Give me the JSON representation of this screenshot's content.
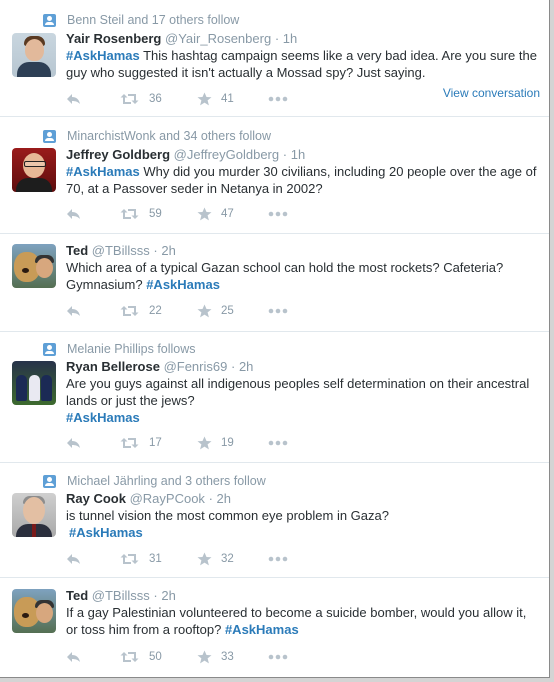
{
  "tweets": [
    {
      "context": "Benn Steil and 17 others follow",
      "fullname": "Yair Rosenberg",
      "handle": "@Yair_Rosenberg",
      "time": "1h",
      "hashtag": "#AskHamas",
      "text_after": " This hashtag campaign seems like a very bad idea. Are you sure the guy who suggested it isn't actually a Mossad spy? Just saying.",
      "retweets": "36",
      "favorites": "41",
      "view_conversation": "View conversation"
    },
    {
      "context": "MinarchistWonk and 34 others follow",
      "fullname": "Jeffrey Goldberg",
      "handle": "@JeffreyGoldberg",
      "time": "1h",
      "hashtag": "#AskHamas",
      "text_after": " Why did you murder 30 civilians, including 20 people over the age of 70, at a Passover seder in Netanya in 2002?",
      "retweets": "59",
      "favorites": "47"
    },
    {
      "fullname": "Ted",
      "handle": "@TBillsss",
      "time": "2h",
      "text_before": "Which area of a typical Gazan school can hold the most rockets? Cafeteria? Gymnasium? ",
      "hashtag": "#AskHamas",
      "retweets": "22",
      "favorites": "25"
    },
    {
      "context": "Melanie Phillips follows",
      "fullname": "Ryan Bellerose",
      "handle": "@Fenris69",
      "time": "2h",
      "text_before": "Are you guys against all indigenous peoples self determination on their ancestral lands or just the jews?",
      "hashtag": "#AskHamas",
      "retweets": "17",
      "favorites": "19"
    },
    {
      "context": "Michael Jährling and 3 others follow",
      "fullname": "Ray Cook",
      "handle": "@RayPCook",
      "time": "2h",
      "text_before": "is tunnel vision the most common eye problem in Gaza?",
      "hashtag": "#AskHamas",
      "retweets": "31",
      "favorites": "32"
    },
    {
      "fullname": "Ted",
      "handle": "@TBillsss",
      "time": "2h",
      "text_before": "If a gay Palestinian volunteered to become a suicide bomber, would you allow it, or toss him from a rooftop? ",
      "hashtag": "#AskHamas",
      "retweets": "50",
      "favorites": "33"
    }
  ],
  "sep": "·",
  "icons": {
    "context": "person-icon",
    "reply": "reply-icon",
    "retweet": "retweet-icon",
    "favorite": "star-icon",
    "more": "more-icon"
  },
  "colors": {
    "link": "#2b7bb9",
    "muted": "#8899a6",
    "text": "#292f33"
  }
}
